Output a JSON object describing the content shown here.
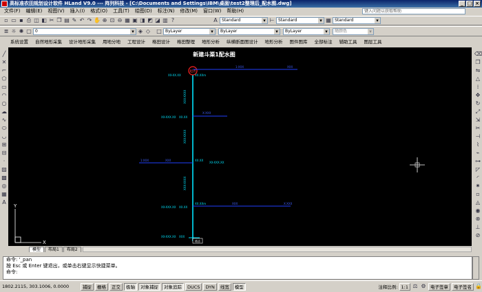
{
  "window": {
    "title": "高标准农田规划设计软件 HLand V9.0 --- 阵列科技 - [C:\\Documents and Settings\\IBM\\桌面\\test2整理后_配水图.dwg]",
    "min": "_",
    "max": "□",
    "close": "×"
  },
  "menubar": {
    "items": [
      "文件(F)",
      "编辑(E)",
      "视图(V)",
      "插入(I)",
      "格式(O)",
      "工具(T)",
      "绘图(D)",
      "标注(N)",
      "修改(M)",
      "窗口(W)",
      "帮助(H)"
    ],
    "help_placeholder": "键入问题以获取帮助"
  },
  "toolbar_std": {
    "style1": "Standard",
    "style2": "Standard",
    "style3": "Standard"
  },
  "toolbar_layers": {
    "layer": "0",
    "color": "ByLayer",
    "linetype": "ByLayer",
    "lineweight": "ByLayer",
    "plotstyle": "随颜色"
  },
  "custom_menu": {
    "items": [
      "系统设置",
      "自然地形采集",
      "设计地形采集",
      "用地分地",
      "工程设计",
      "格田设计",
      "格田整理",
      "地形分析",
      "纵横断面图设计",
      "地形分析",
      "图件图库",
      "全部标注",
      "辅助工具",
      "图层工具"
    ]
  },
  "drawing": {
    "title": "新建斗渠1配水图",
    "source_label": "起点",
    "end_label": "终点",
    "labels": {
      "l1": "XX-XX.XX",
      "l2": "XX.XXm",
      "l3": "XXX-XXXX",
      "l4": "XX.XX",
      "l5": "XX-XXX.XX",
      "l6": "XXX"
    },
    "pipe_labels": [
      "1:XXX",
      "XXX",
      "X:XXX"
    ]
  },
  "tabs": [
    "模型",
    "布局1",
    "布局2"
  ],
  "command": {
    "line1": "命令: '_pan",
    "line2": "按 Esc 或 Enter 键退出，或单击右键显示快捷菜单。",
    "line3": "命令:"
  },
  "statusbar": {
    "coords": "1802.2115, 303.1006, 0.0000",
    "buttons": [
      "捕捉",
      "栅格",
      "正交",
      "极轴",
      "对象捕捉",
      "对象追踪",
      "DUCS",
      "DYN",
      "线宽",
      "模型"
    ],
    "annot_label": "注释比例:",
    "annot_value": "1:1",
    "sign1": "电子签章",
    "sign2": "电子签名"
  }
}
